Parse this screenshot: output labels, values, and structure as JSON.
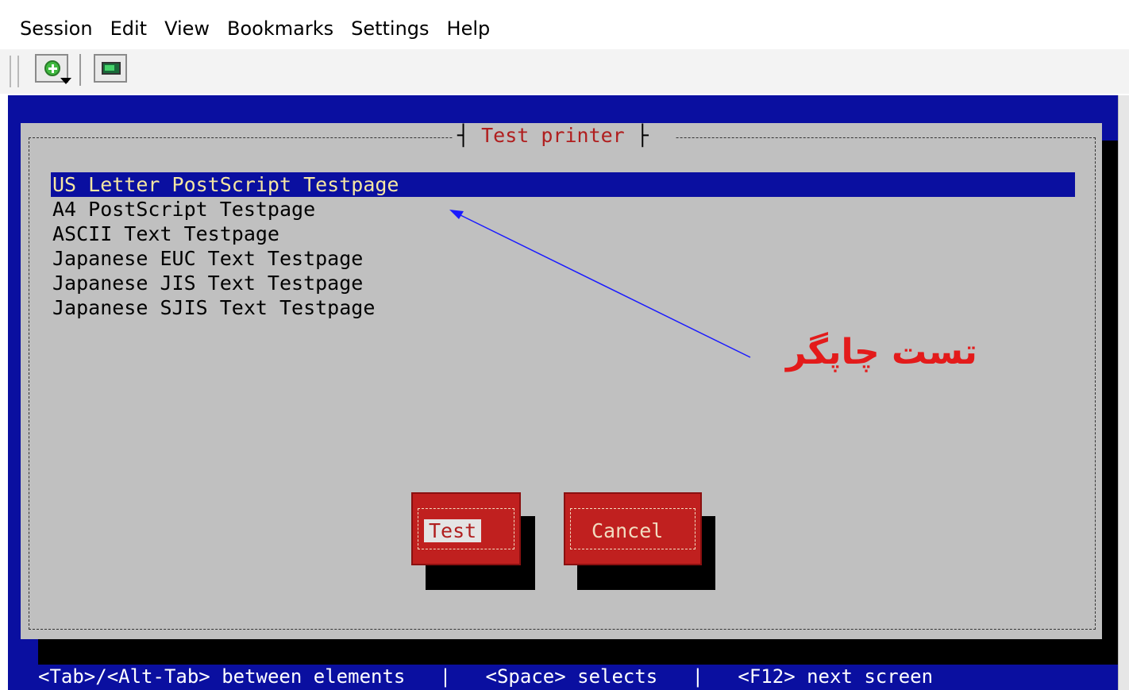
{
  "menubar": {
    "items": [
      "Session",
      "Edit",
      "View",
      "Bookmarks",
      "Settings",
      "Help"
    ]
  },
  "toolbar": {
    "new_session_icon": "add-session-icon",
    "terminal_icon": "terminal-icon"
  },
  "dialog": {
    "title": "Test printer",
    "items": [
      "US Letter PostScript Testpage",
      "A4 PostScript Testpage",
      "ASCII Text Testpage",
      "Japanese EUC Text Testpage",
      "Japanese JIS Text Testpage",
      "Japanese SJIS Text Testpage"
    ],
    "selected_index": 0,
    "buttons": {
      "test_label": "Test",
      "cancel_label": "Cancel"
    }
  },
  "statusbar": {
    "text": "<Tab>/<Alt-Tab> between elements   |   <Space> selects   |   <F12> next screen"
  },
  "annotation": {
    "text": "تست چاپگر"
  },
  "colors": {
    "terminal_bg": "#0a0fa0",
    "dialog_bg": "#c0c0c0",
    "button_red": "#c0201f",
    "annotation_red": "#e31b1b",
    "arrow_blue": "#1a1aff"
  }
}
